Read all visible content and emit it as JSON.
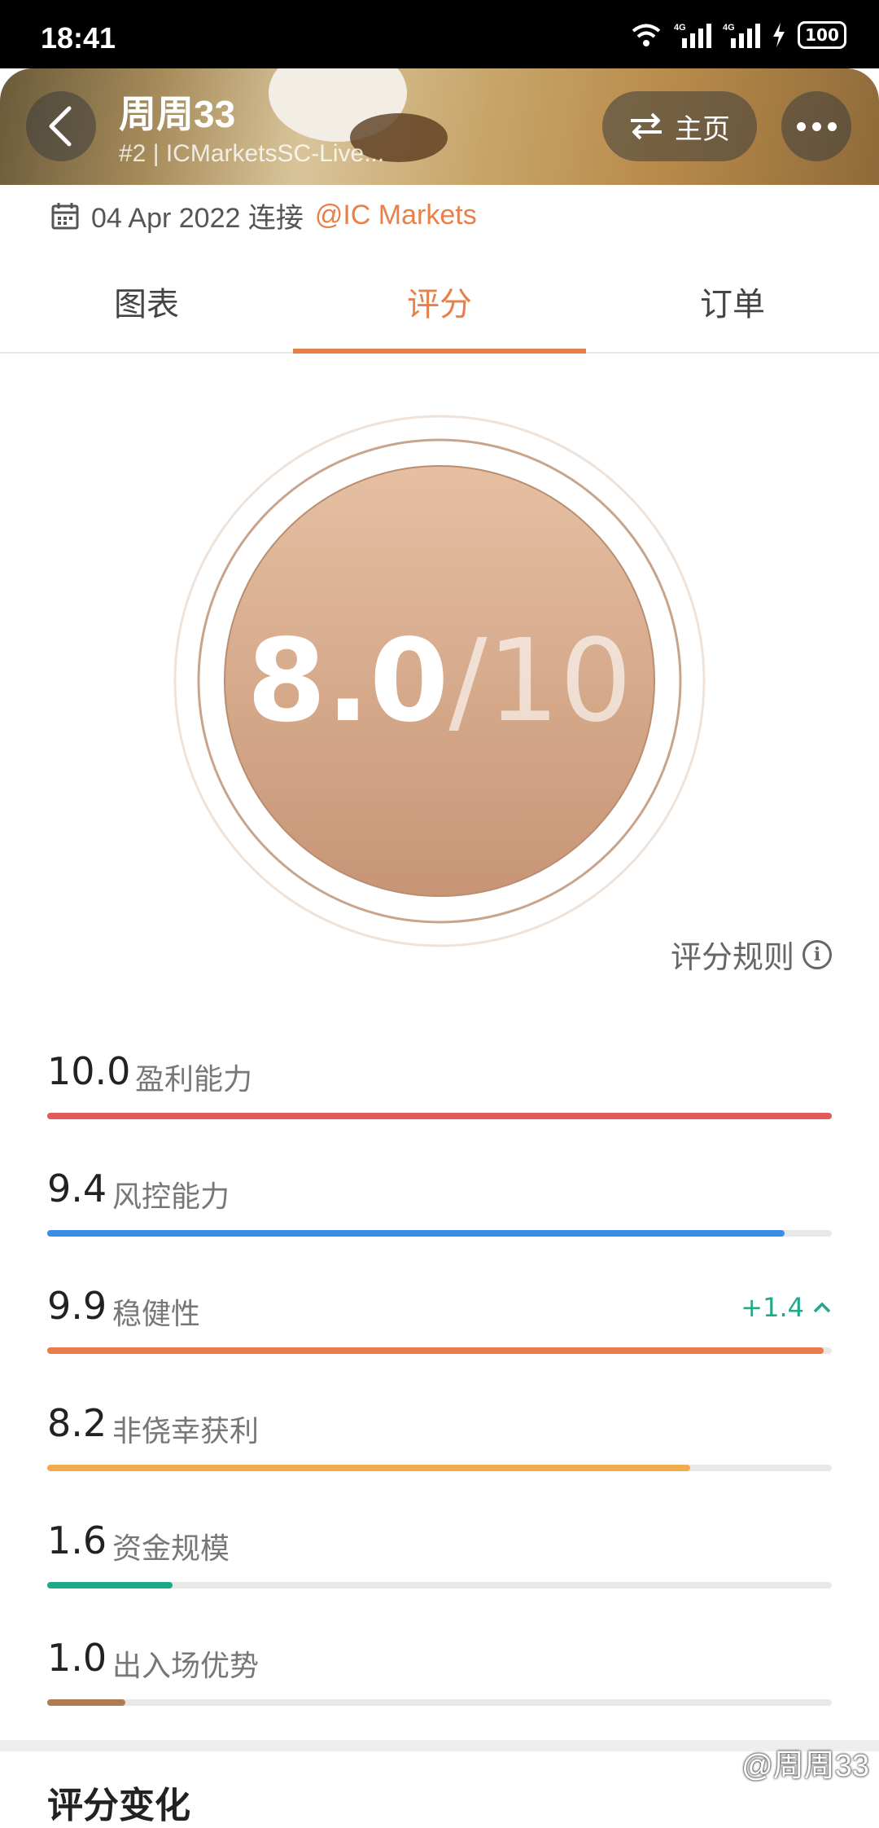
{
  "status_bar": {
    "time": "18:41",
    "battery": "100",
    "network_1": "4G",
    "network_2": "4G"
  },
  "header": {
    "name": "周周33",
    "subtitle": "#2 | ICMarketsSC-Live...",
    "home_label": "主页"
  },
  "connect": {
    "date": "04 Apr 2022 连接",
    "broker": "@IC Markets"
  },
  "tabs": [
    {
      "label": "图表"
    },
    {
      "label": "评分"
    },
    {
      "label": "订单"
    }
  ],
  "active_tab": "评分",
  "score": {
    "value": "8.0",
    "total": "/10"
  },
  "rules_label": "评分规则",
  "metrics": [
    {
      "value": "10.0",
      "label": "盈利能力",
      "fraction": 1.0,
      "color": "#e05a58"
    },
    {
      "value": "9.4",
      "label": "风控能力",
      "fraction": 0.94,
      "color": "#3d8be8"
    },
    {
      "value": "9.9",
      "label": "稳健性",
      "fraction": 0.99,
      "color": "#ec7b4b",
      "delta": "+1.4"
    },
    {
      "value": "8.2",
      "label": "非侥幸获利",
      "fraction": 0.82,
      "color": "#f0ab4c"
    },
    {
      "value": "1.6",
      "label": "资金规模",
      "fraction": 0.16,
      "color": "#1fa98a"
    },
    {
      "value": "1.0",
      "label": "出入场优势",
      "fraction": 0.1,
      "color": "#b07b50"
    }
  ],
  "section_title": "评分变化",
  "watermark": "@周周33",
  "colors": {
    "accent": "#e8804a",
    "positive": "#22a88a"
  }
}
